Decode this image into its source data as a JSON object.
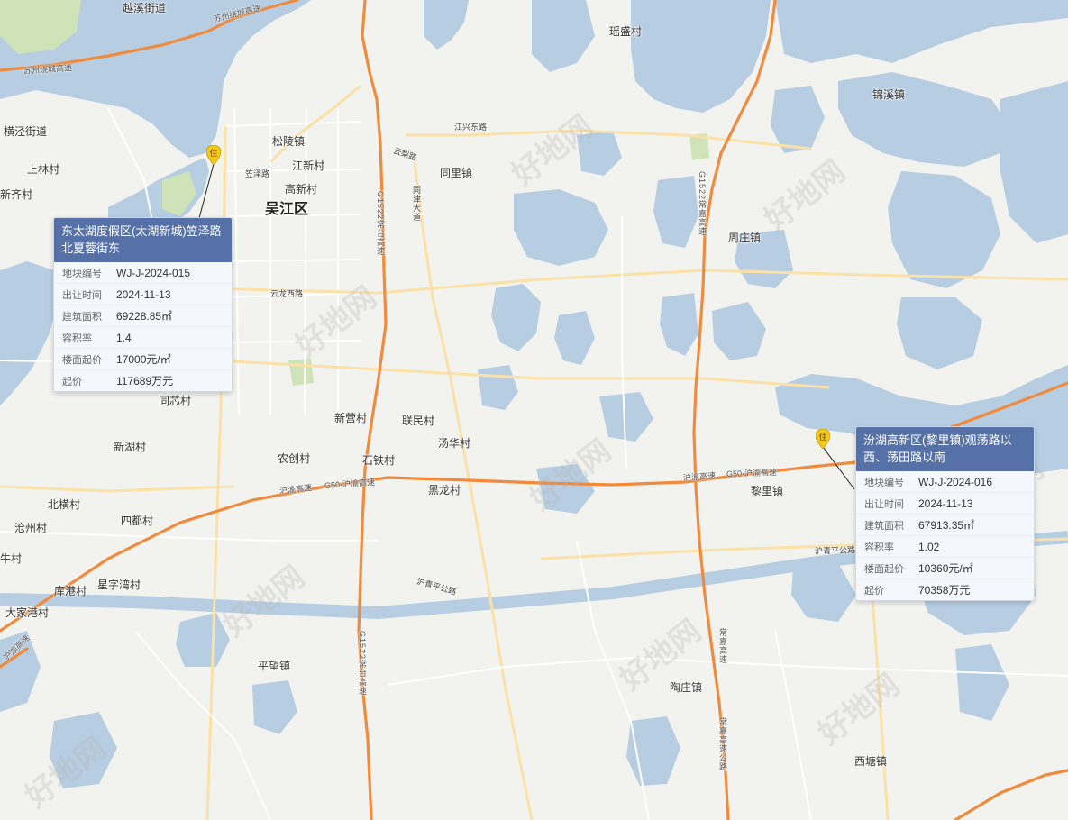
{
  "map": {
    "colors": {
      "land": "#f2f2ef",
      "water": "#b7cde2",
      "green": "#cfe3b8",
      "highway": "#f08a3c",
      "arterial": "#fbe1a8",
      "minor": "#ffffff",
      "card_header": "#5571a7",
      "pin": "#f6c915"
    },
    "places": [
      {
        "name": "越溪街道"
      },
      {
        "name": "瑶盛村"
      },
      {
        "name": "锦溪镇"
      },
      {
        "name": "横泾街道"
      },
      {
        "name": "松陵镇"
      },
      {
        "name": "江新村"
      },
      {
        "name": "上林村"
      },
      {
        "name": "新齐村"
      },
      {
        "name": "高新村"
      },
      {
        "name": "同里镇"
      },
      {
        "name": "吴江区"
      },
      {
        "name": "周庄镇"
      },
      {
        "name": "同芯村"
      },
      {
        "name": "新营村"
      },
      {
        "name": "联民村"
      },
      {
        "name": "新湖村"
      },
      {
        "name": "汤华村"
      },
      {
        "name": "农创村"
      },
      {
        "name": "石铁村"
      },
      {
        "name": "黑龙村"
      },
      {
        "name": "黎里镇"
      },
      {
        "name": "北横村"
      },
      {
        "name": "四都村"
      },
      {
        "name": "沧州村"
      },
      {
        "name": "牛村"
      },
      {
        "name": "星字湾村"
      },
      {
        "name": "库港村"
      },
      {
        "name": "大家港村"
      },
      {
        "name": "平望镇"
      },
      {
        "name": "陶庄镇"
      },
      {
        "name": "西塘镇"
      }
    ],
    "roads": [
      {
        "name": "苏州绕城高速"
      },
      {
        "name": "苏州绕城高速"
      },
      {
        "name": "江兴东路"
      },
      {
        "name": "云梨路"
      },
      {
        "name": "笠泽路"
      },
      {
        "name": "同津大道"
      },
      {
        "name": "G1522常台高速"
      },
      {
        "name": "G1522常嘉高速"
      },
      {
        "name": "云龙西路"
      },
      {
        "name": "沪渝高速"
      },
      {
        "name": "G50·沪渝高速"
      },
      {
        "name": "沪渝高速"
      },
      {
        "name": "G50·沪渝高速"
      },
      {
        "name": "沪青平公路"
      },
      {
        "name": "沪青平公路"
      },
      {
        "name": "G1522常台高速"
      },
      {
        "name": "常嘉高速"
      },
      {
        "name": "常嘉高速公路"
      },
      {
        "name": "沪渝高速"
      }
    ],
    "pins": [
      {
        "name": "住"
      },
      {
        "name": "住"
      }
    ],
    "watermark": "好地网"
  },
  "cards": [
    {
      "title": "东太湖度假区(太湖新城)笠泽路北夏蓉街东",
      "rows": [
        {
          "label": "地块编号",
          "value": "WJ-J-2024-015"
        },
        {
          "label": "出让时间",
          "value": "2024-11-13"
        },
        {
          "label": "建筑面积",
          "value": "69228.85㎡"
        },
        {
          "label": "容积率",
          "value": "1.4"
        },
        {
          "label": "楼面起价",
          "value": "17000元/㎡"
        },
        {
          "label": "起价",
          "value": "117689万元"
        }
      ]
    },
    {
      "title": "汾湖高新区(黎里镇)观荡路以西、荡田路以南",
      "rows": [
        {
          "label": "地块编号",
          "value": "WJ-J-2024-016"
        },
        {
          "label": "出让时间",
          "value": "2024-11-13"
        },
        {
          "label": "建筑面积",
          "value": "67913.35㎡"
        },
        {
          "label": "容积率",
          "value": "1.02"
        },
        {
          "label": "楼面起价",
          "value": "10360元/㎡"
        },
        {
          "label": "起价",
          "value": "70358万元"
        }
      ]
    }
  ]
}
